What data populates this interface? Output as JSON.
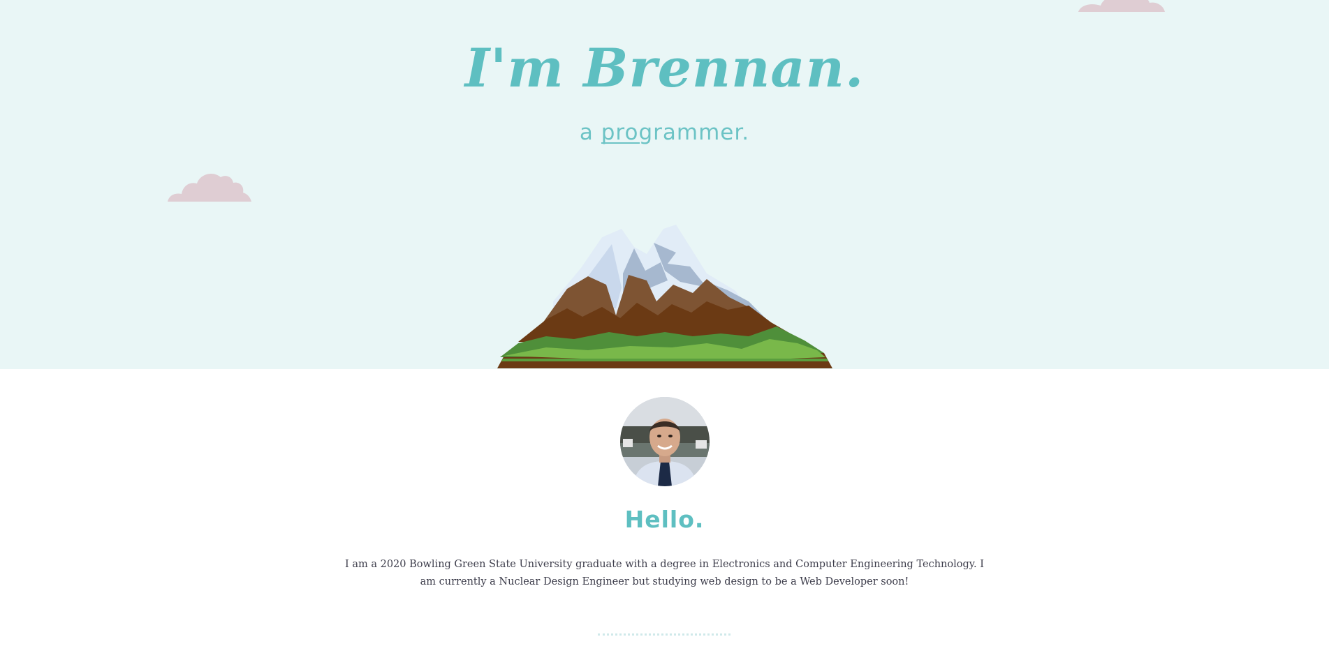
{
  "hero": {
    "title": "I'm Brennan.",
    "subtitle_prefix": "a ",
    "subtitle_word": "programmer.",
    "background_color": "#e9f6f6",
    "accent_color": "#5ebfc1"
  },
  "decorations": {
    "clouds": [
      "cloud-left",
      "cloud-right"
    ],
    "cloud_color": "#dfcdd3",
    "illustration": "snowy-mountain"
  },
  "about": {
    "avatar_alt": "Portrait of Brennan",
    "heading": "Hello.",
    "text": "I am a 2020 Bowling Green State University graduate with a degree in Electronics and Computer Engineering Technology. I am currently a Nuclear Design Engineer but studying web design to be a Web Developer soon!",
    "text_color": "#3c3c4a"
  }
}
